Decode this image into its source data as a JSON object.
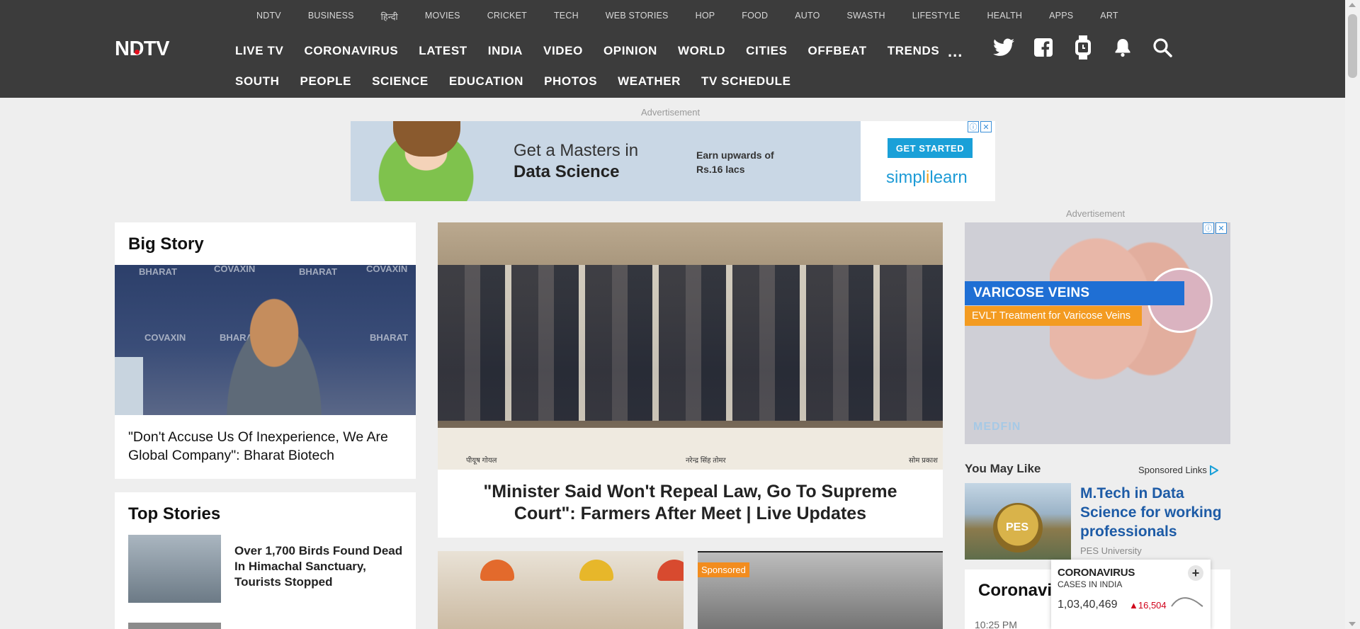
{
  "top_nav": [
    "NDTV",
    "BUSINESS",
    "हिन्दी",
    "MOVIES",
    "CRICKET",
    "TECH",
    "WEB STORIES",
    "HOP",
    "FOOD",
    "AUTO",
    "SWASTH",
    "LIFESTYLE",
    "HEALTH",
    "APPS",
    "ART"
  ],
  "logo": "NDTV",
  "main_nav": [
    "LIVE TV",
    "CORONAVIRUS",
    "LATEST",
    "INDIA",
    "VIDEO",
    "OPINION",
    "WORLD",
    "CITIES",
    "OFFBEAT",
    "TRENDS"
  ],
  "sub_nav": [
    "SOUTH",
    "PEOPLE",
    "SCIENCE",
    "EDUCATION",
    "PHOTOS",
    "WEATHER",
    "TV SCHEDULE"
  ],
  "more_label": "...",
  "icons": [
    "twitter-icon",
    "facebook-icon",
    "smartwatch-icon",
    "bell-icon",
    "search-icon"
  ],
  "ads": {
    "label": "Advertisement",
    "top": {
      "line1": "Get a Masters in",
      "line2": "Data Science",
      "earn1": "Earn upwards of",
      "earn2": "Rs.16 lacs",
      "cta": "GET STARTED",
      "brand_a": "simpl",
      "brand_b": "i",
      "brand_c": "learn"
    },
    "right": {
      "banner1": "VARICOSE VEINS",
      "banner2": "EVLT Treatment for Varicose Veins",
      "brand": "MEDFIN"
    },
    "info_glyph": "ⓘ",
    "close_glyph": "✕"
  },
  "big_story": {
    "heading": "Big Story",
    "watermark": "COVAXIN",
    "watermark2": "BHARAT",
    "title": "\"Don't Accuse Us Of Inexperience, We Are Global Company\": Bharat Biotech"
  },
  "lead_story": {
    "caption_left": "पीयूष गोयल",
    "caption_mid": "नरेन्द्र सिंह तोमर",
    "caption_right": "सोम प्रकाश",
    "title": "\"Minister Said Won't Repeal Law, Go To Supreme Court\": Farmers After Meet | Live Updates"
  },
  "top_stories": {
    "heading": "Top Stories",
    "items": [
      {
        "title": "Over 1,700 Birds Found Dead In Himachal Sanctuary, Tourists Stopped"
      }
    ]
  },
  "sponsored_label": "Sponsored",
  "you_may_like": {
    "heading": "You May Like",
    "sponsored": "Sponsored Links",
    "item_title": "M.Tech in Data Science for working professionals",
    "item_source": "PES University",
    "thumb_text": "PES"
  },
  "corona_card": {
    "heading": "Coronavi",
    "time": "10:25 PM"
  },
  "covid_widget": {
    "title": "CORONAVIRUS",
    "subtitle": "CASES IN INDIA",
    "cases": "1,03,40,469",
    "delta": "16,504",
    "plus": "+"
  }
}
